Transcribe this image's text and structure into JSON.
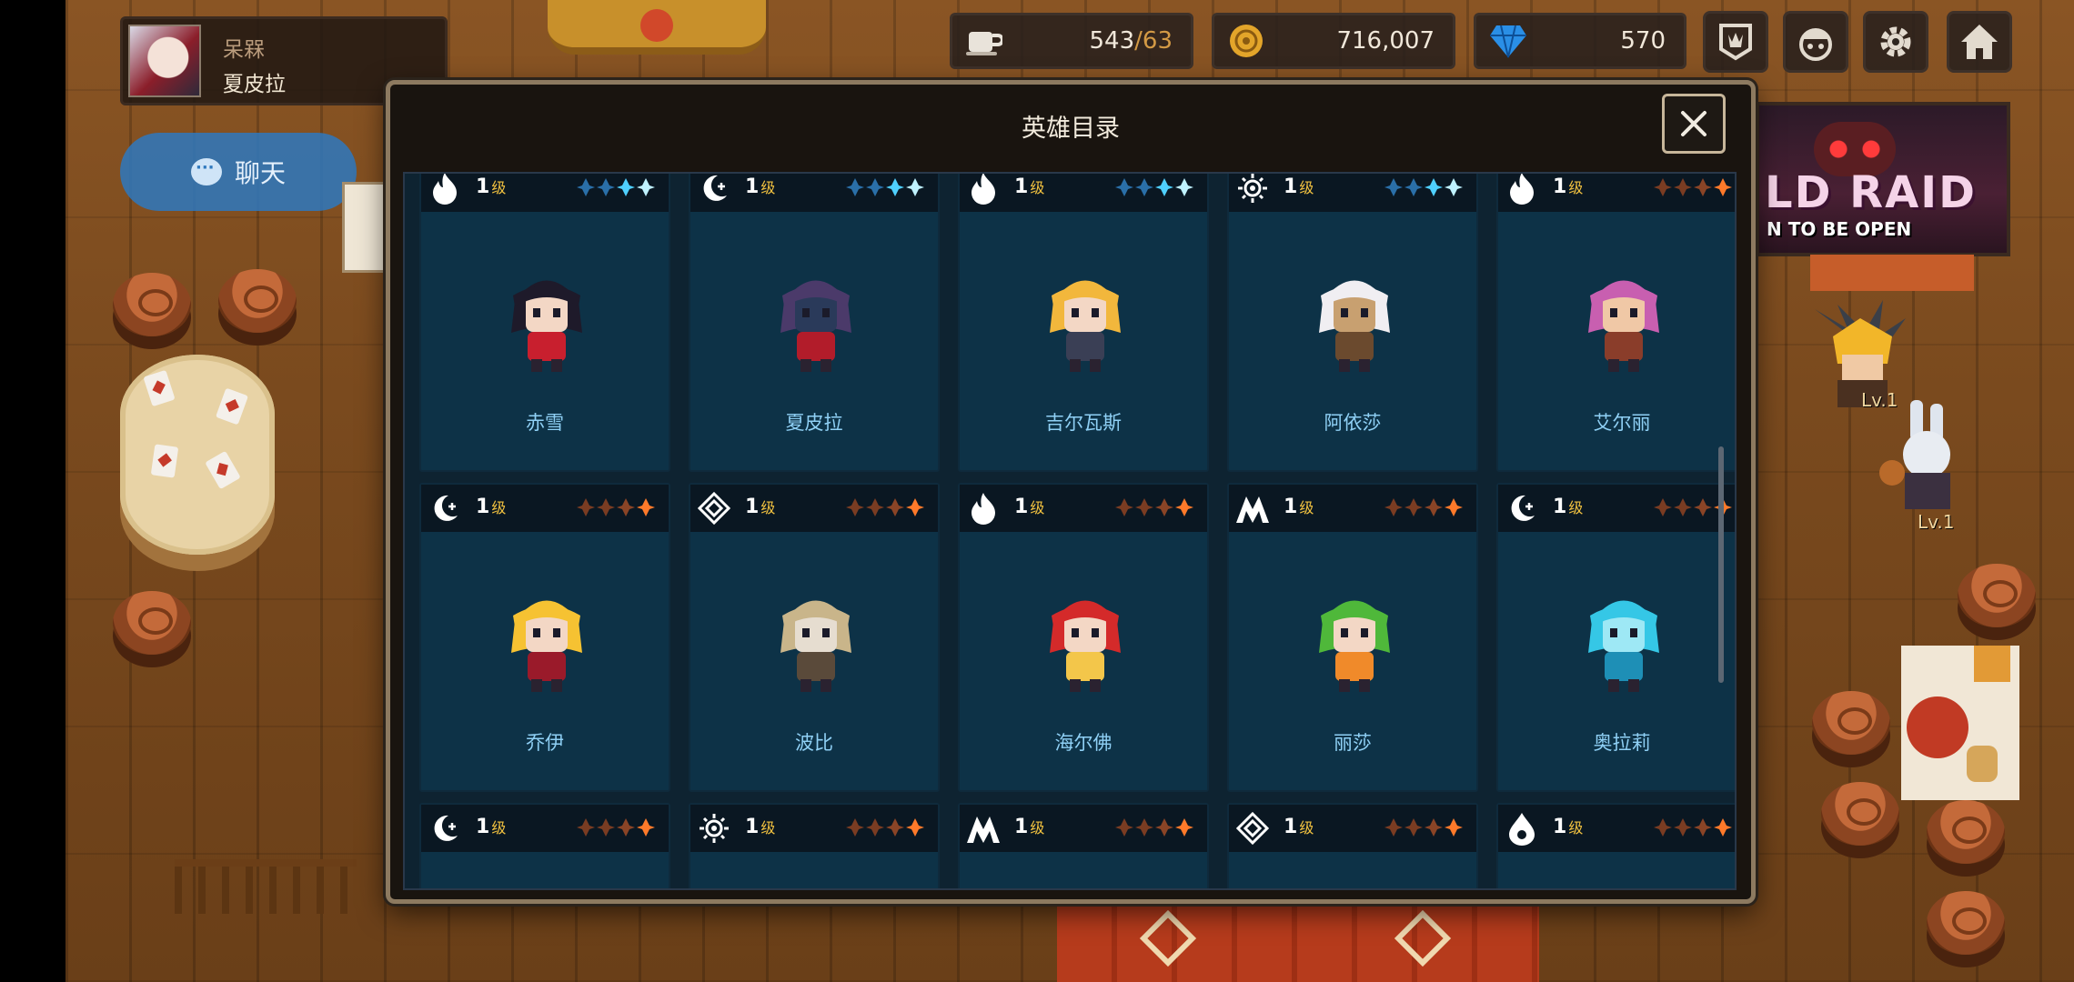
{
  "player": {
    "top_label": "呆槑",
    "name": "夏皮拉"
  },
  "chat": {
    "label": "聊天"
  },
  "resources": {
    "stamina": {
      "icon": "coffee-cup-icon",
      "current": "543",
      "cap": "/63"
    },
    "gold": {
      "icon": "gold-coin-icon",
      "value": "716,007"
    },
    "gems": {
      "icon": "blue-gem-icon",
      "value": "570"
    }
  },
  "hud_buttons": [
    "guild-banner-icon",
    "hero-face-icon",
    "gear-icon",
    "home-icon"
  ],
  "raid_poster": {
    "line1": "LD RAID",
    "line2": "N TO BE OPEN"
  },
  "npc_levels": [
    "Lv.1",
    "Lv.1"
  ],
  "modal": {
    "title": "英雄目录",
    "close": "×",
    "level_suffix": "级",
    "heroes": [
      {
        "name": "赤雪",
        "element": "fire",
        "level": "1",
        "stars": "blue",
        "colors": [
          "#1e1a2a",
          "#c81f2e",
          "#f3d7c5"
        ]
      },
      {
        "name": "夏皮拉",
        "element": "moon",
        "level": "1",
        "stars": "blue",
        "colors": [
          "#4b3a6a",
          "#b21c2a",
          "#2a3a5a"
        ]
      },
      {
        "name": "吉尔瓦斯",
        "element": "fire",
        "level": "1",
        "stars": "blue",
        "colors": [
          "#f2b73c",
          "#3a3f55",
          "#f3d7c5"
        ]
      },
      {
        "name": "阿依莎",
        "element": "sun",
        "level": "1",
        "stars": "blue",
        "colors": [
          "#f0eef2",
          "#6b4a2e",
          "#c8a070"
        ]
      },
      {
        "name": "艾尔丽",
        "element": "fire",
        "level": "1",
        "stars": "orange",
        "colors": [
          "#c85fb0",
          "#8a3d2a",
          "#f0c8a6"
        ]
      },
      {
        "name": "乔伊",
        "element": "moon",
        "level": "1",
        "stars": "orange",
        "colors": [
          "#f6c232",
          "#9a1a2a",
          "#f3d7c5"
        ]
      },
      {
        "name": "波比",
        "element": "diamond",
        "level": "1",
        "stars": "orange",
        "colors": [
          "#c9b58a",
          "#5a4a3a",
          "#e6ddd0"
        ]
      },
      {
        "name": "海尔佛",
        "element": "fire",
        "level": "1",
        "stars": "orange",
        "colors": [
          "#d42a2a",
          "#f3c64a",
          "#f3d7c5"
        ]
      },
      {
        "name": "丽莎",
        "element": "mountain",
        "level": "1",
        "stars": "orange",
        "colors": [
          "#4fb83a",
          "#f08a2a",
          "#f3d7c5"
        ]
      },
      {
        "name": "奥拉莉",
        "element": "moon",
        "level": "1",
        "stars": "orange",
        "colors": [
          "#35c7e6",
          "#1e8fb6",
          "#9ee8f5"
        ]
      },
      {
        "name": "",
        "element": "moon",
        "level": "1",
        "stars": "orange",
        "colors": []
      },
      {
        "name": "",
        "element": "sun",
        "level": "1",
        "stars": "orange",
        "colors": []
      },
      {
        "name": "",
        "element": "mountain",
        "level": "1",
        "stars": "orange",
        "colors": []
      },
      {
        "name": "",
        "element": "diamond",
        "level": "1",
        "stars": "orange",
        "colors": []
      },
      {
        "name": "",
        "element": "water",
        "level": "1",
        "stars": "orange",
        "colors": []
      }
    ]
  }
}
